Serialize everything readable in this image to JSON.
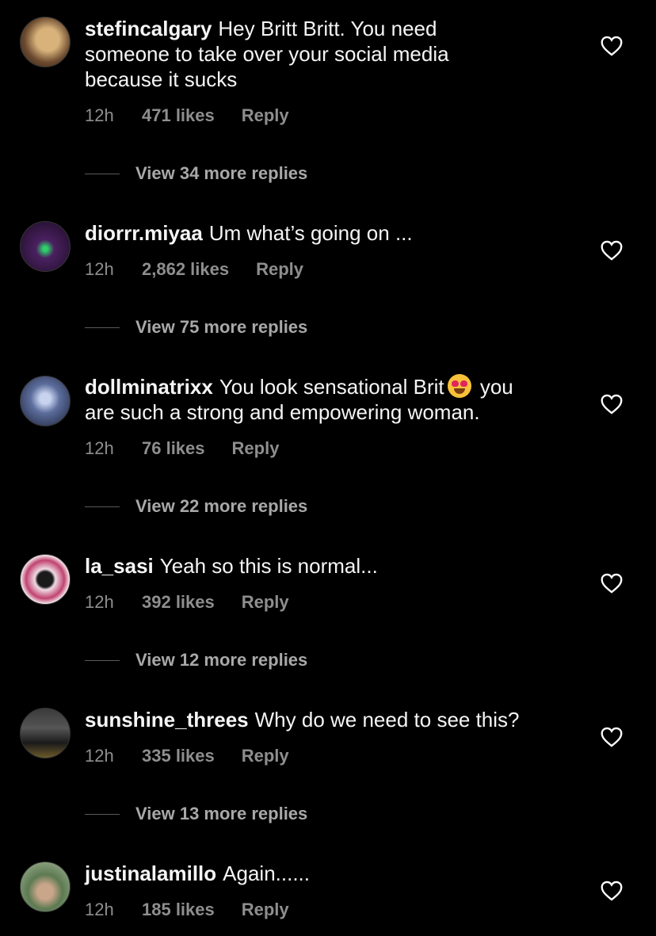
{
  "comments": [
    {
      "username": "stefincalgary",
      "text_lines": [
        "Hey Britt Britt. You need",
        "someone to take over your social media",
        "because it sucks"
      ],
      "time": "12h",
      "likes": "471 likes",
      "reply": "Reply",
      "view_replies": "View 34 more replies",
      "avatar_colors": [
        "#6b4a2f",
        "#c9a06a"
      ]
    },
    {
      "username": "diorrr.miyaa",
      "text_lines": [
        "Um what’s going on ..."
      ],
      "time": "12h",
      "likes": "2,862 likes",
      "reply": "Reply",
      "view_replies": "View 75 more replies",
      "avatar_colors": [
        "#2a1233",
        "#6a3a8a"
      ]
    },
    {
      "username": "dollminatrixx",
      "text_before_emoji": "You look sensational Brit",
      "emoji": "heart-eyes-emoji",
      "text_after_emoji": " you",
      "text_line2": "are such a strong and empowering woman.",
      "time": "12h",
      "likes": "76 likes",
      "reply": "Reply",
      "view_replies": "View 22 more replies",
      "avatar_colors": [
        "#1e2440",
        "#7f8fb8"
      ]
    },
    {
      "username": "la_sasi",
      "text_lines": [
        "Yeah so this is normal..."
      ],
      "time": "12h",
      "likes": "392 likes",
      "reply": "Reply",
      "view_replies": "View 12 more replies",
      "avatar_colors": [
        "#b83a6a",
        "#f2e6ec"
      ]
    },
    {
      "username": "sunshine_threes",
      "text_lines": [
        "Why do we need to see this?"
      ],
      "time": "12h",
      "likes": "335 likes",
      "reply": "Reply",
      "view_replies": "View 13 more replies",
      "avatar_colors": [
        "#222222",
        "#777777"
      ]
    },
    {
      "username": "justinalamillo",
      "text_lines": [
        "Again......"
      ],
      "time": "12h",
      "likes": "185 likes",
      "reply": "Reply",
      "avatar_colors": [
        "#3f5a3a",
        "#a8b79a"
      ]
    }
  ],
  "colors": {
    "background": "#000000",
    "text": "#f5f5f5",
    "muted": "#8e8e8e"
  },
  "icons": {
    "like": "heart-outline-icon"
  }
}
